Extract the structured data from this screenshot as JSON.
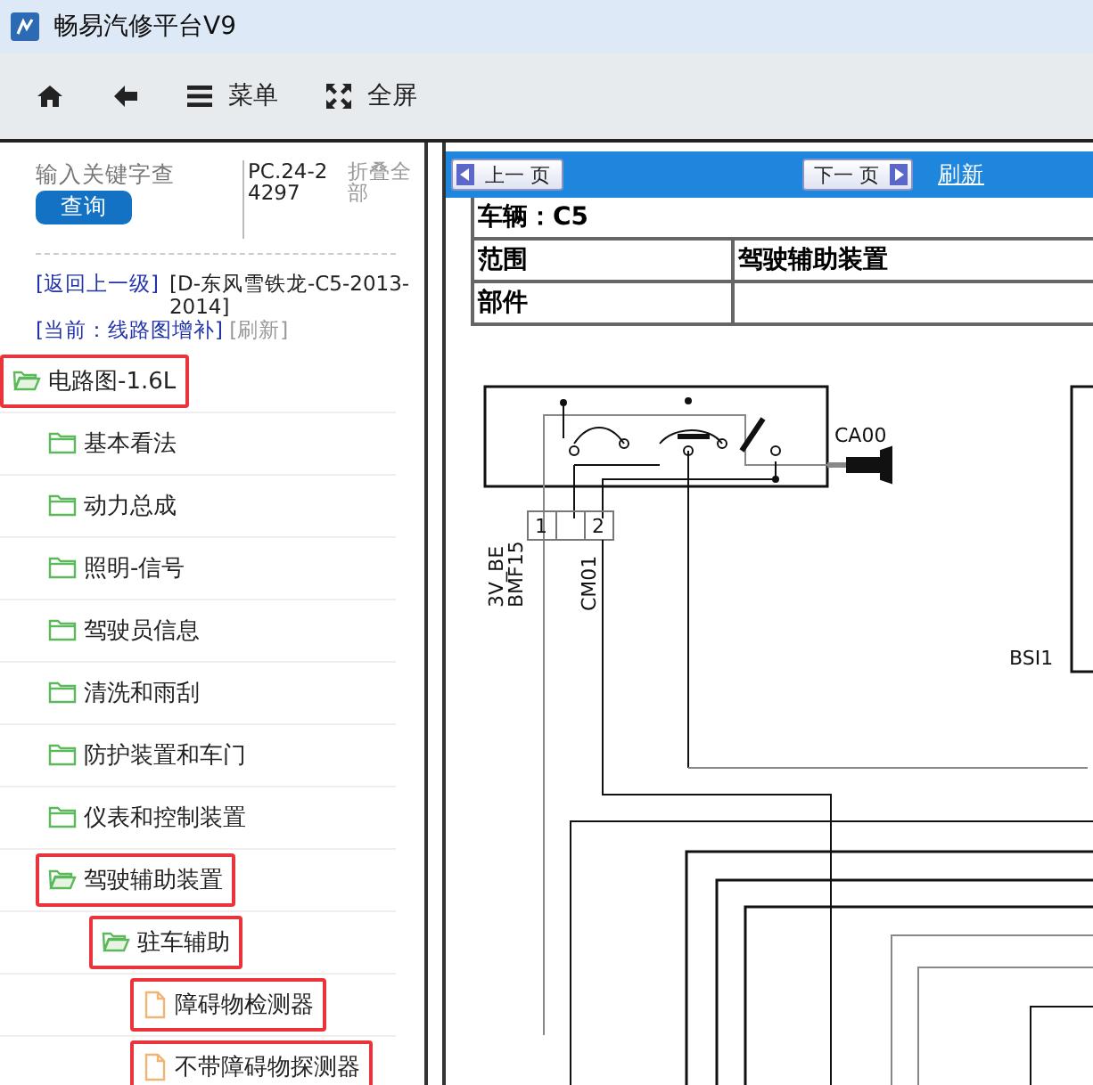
{
  "window": {
    "title": "畅易汽修平台V9"
  },
  "toolbar": [
    {
      "kind": "home"
    },
    {
      "kind": "back"
    },
    {
      "kind": "menu",
      "label": "菜单"
    },
    {
      "kind": "fullscreen",
      "label": "全屏"
    }
  ],
  "search": {
    "placeholder": "输入关键字查",
    "button": "查询",
    "code": "PC.24-24297",
    "collapse": "折叠全部"
  },
  "breadcrumb": {
    "back": "[返回上一级]",
    "path": "[D-东风雪铁龙-C5-2013-2014]",
    "current": "[当前：线路图增补]",
    "refresh": "[刷新]"
  },
  "tree": [
    {
      "label": "电路图-1.6L",
      "kind": "folder",
      "expanded": true,
      "highlighted": true,
      "children": [
        {
          "label": "基本看法",
          "kind": "folder",
          "expanded": false,
          "highlighted": false
        },
        {
          "label": "动力总成",
          "kind": "folder",
          "expanded": false,
          "highlighted": false
        },
        {
          "label": "照明-信号",
          "kind": "folder",
          "expanded": false,
          "highlighted": false
        },
        {
          "label": "驾驶员信息",
          "kind": "folder",
          "expanded": false,
          "highlighted": false
        },
        {
          "label": "清洗和雨刮",
          "kind": "folder",
          "expanded": false,
          "highlighted": false
        },
        {
          "label": "防护装置和车门",
          "kind": "folder",
          "expanded": false,
          "highlighted": false
        },
        {
          "label": "仪表和控制装置",
          "kind": "folder",
          "expanded": false,
          "highlighted": false
        },
        {
          "label": "驾驶辅助装置",
          "kind": "folder",
          "expanded": true,
          "highlighted": true,
          "children": [
            {
              "label": "驻车辅助",
              "kind": "folder",
              "expanded": true,
              "highlighted": true,
              "children": [
                {
                  "label": "障碍物检测器",
                  "kind": "file",
                  "highlighted": true
                },
                {
                  "label": "不带障碍物探测器",
                  "kind": "file",
                  "highlighted": true
                }
              ]
            }
          ]
        }
      ]
    }
  ],
  "viewer": {
    "prev": "上一 页",
    "next": "下一 页",
    "refresh": "刷新",
    "vehicle": "车辆：C5",
    "rows": [
      {
        "label": "范围",
        "value": "驾驶辅助装置"
      },
      {
        "label": "部件",
        "value": ""
      }
    ],
    "diagram_labels": {
      "switch": "CA00",
      "pin_1": "1",
      "pin_2": "2",
      "wire_1a": "3V_BE",
      "wire_1b": "BMF15",
      "wire_2": "CM01",
      "unit": "BSI1"
    }
  }
}
